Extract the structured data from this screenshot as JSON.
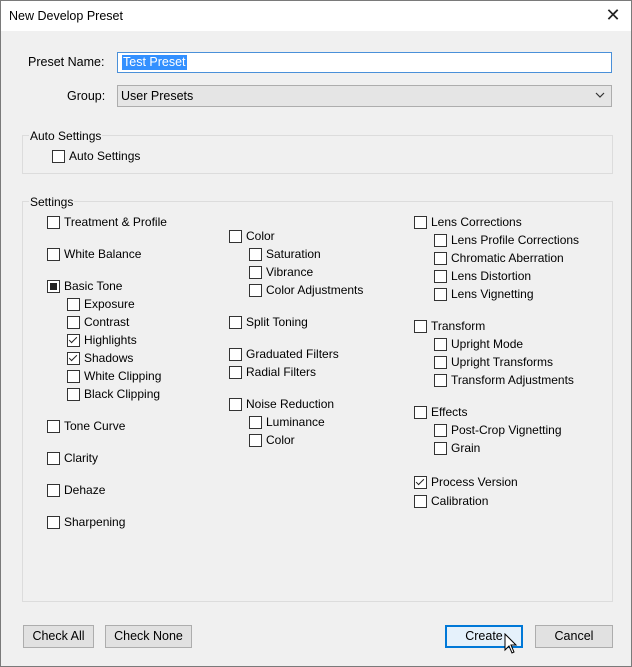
{
  "window": {
    "title": "New Develop Preset",
    "close_glyph": "✕"
  },
  "form": {
    "preset_name_label": "Preset Name:",
    "preset_name_value": "Test Preset",
    "group_label": "Group:",
    "group_value": "User Presets"
  },
  "auto_settings": {
    "legend": "Auto Settings",
    "checkbox_label": "Auto Settings",
    "checked": false
  },
  "settings": {
    "legend": "Settings",
    "col1": [
      {
        "label": "Treatment & Profile",
        "state": "unchecked"
      },
      {
        "label": "White Balance",
        "state": "unchecked"
      },
      {
        "label": "Basic Tone",
        "state": "mixed"
      },
      {
        "label": "Exposure",
        "state": "unchecked"
      },
      {
        "label": "Contrast",
        "state": "unchecked"
      },
      {
        "label": "Highlights",
        "state": "checked"
      },
      {
        "label": "Shadows",
        "state": "checked"
      },
      {
        "label": "White Clipping",
        "state": "unchecked"
      },
      {
        "label": "Black Clipping",
        "state": "unchecked"
      },
      {
        "label": "Tone Curve",
        "state": "unchecked"
      },
      {
        "label": "Clarity",
        "state": "unchecked"
      },
      {
        "label": "Dehaze",
        "state": "unchecked"
      },
      {
        "label": "Sharpening",
        "state": "unchecked"
      }
    ],
    "col2": [
      {
        "label": "Color",
        "state": "unchecked"
      },
      {
        "label": "Saturation",
        "state": "unchecked"
      },
      {
        "label": "Vibrance",
        "state": "unchecked"
      },
      {
        "label": "Color Adjustments",
        "state": "unchecked"
      },
      {
        "label": "Split Toning",
        "state": "unchecked"
      },
      {
        "label": "Graduated Filters",
        "state": "unchecked"
      },
      {
        "label": "Radial Filters",
        "state": "unchecked"
      },
      {
        "label": "Noise Reduction",
        "state": "unchecked"
      },
      {
        "label": "Luminance",
        "state": "unchecked"
      },
      {
        "label": "Color",
        "state": "unchecked"
      }
    ],
    "col3": [
      {
        "label": "Lens Corrections",
        "state": "unchecked"
      },
      {
        "label": "Lens Profile Corrections",
        "state": "unchecked"
      },
      {
        "label": "Chromatic Aberration",
        "state": "unchecked"
      },
      {
        "label": "Lens Distortion",
        "state": "unchecked"
      },
      {
        "label": "Lens Vignetting",
        "state": "unchecked"
      },
      {
        "label": "Transform",
        "state": "unchecked"
      },
      {
        "label": "Upright Mode",
        "state": "unchecked"
      },
      {
        "label": "Upright Transforms",
        "state": "unchecked"
      },
      {
        "label": "Transform Adjustments",
        "state": "unchecked"
      },
      {
        "label": "Effects",
        "state": "unchecked"
      },
      {
        "label": "Post-Crop Vignetting",
        "state": "unchecked"
      },
      {
        "label": "Grain",
        "state": "unchecked"
      },
      {
        "label": "Process Version",
        "state": "checked"
      },
      {
        "label": "Calibration",
        "state": "unchecked"
      }
    ]
  },
  "buttons": {
    "check_all": "Check All",
    "check_none": "Check None",
    "create": "Create",
    "cancel": "Cancel"
  },
  "colors": {
    "accent": "#0078d7",
    "selection": "#3390ff",
    "background": "#f0f0f0"
  }
}
